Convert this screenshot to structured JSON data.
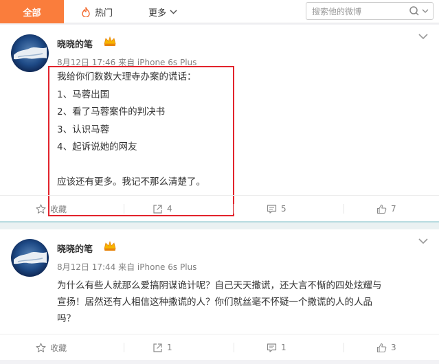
{
  "nav": {
    "tab_all": "全部",
    "tab_hot": "热门",
    "tab_more": "更多",
    "search_placeholder": "搜索他的微博"
  },
  "posts": [
    {
      "author": "晓晓的笔",
      "meta": "8月12日 17:46 来自 iPhone 6s Plus",
      "lines": [
        "我给你们数数大理寺办案的谎话：",
        "1、马蓉出国",
        "2、看了马蓉案件的判决书",
        "3、认识马蓉",
        "4、起诉说她的网友",
        "",
        "应该还有更多。我记不那么清楚了。"
      ],
      "actions": {
        "favorite": "收藏",
        "share": "4",
        "comment": "5",
        "like": "7"
      }
    },
    {
      "author": "晓晓的笔",
      "meta": "8月12日 17:44 来自 iPhone 6s Plus",
      "lines": [
        "为什么有些人就那么爱搞阴谋诡计呢？自己天天撒谎，还大言不惭的四处炫耀与",
        "宣扬！居然还有人相信这种撒谎的人？你们就丝毫不怀疑一个撒谎的人的人品",
        "吗？"
      ],
      "actions": {
        "favorite": "收藏",
        "share": "1",
        "comment": "1",
        "like": "3"
      }
    }
  ],
  "colors": {
    "accent": "#fa7d3c",
    "highlight_border": "#e2232c",
    "divider": "#b7dbe0"
  },
  "icons": [
    "fire-icon",
    "chevron-down-icon",
    "search-icon",
    "vip-badge-icon",
    "star-icon",
    "share-icon",
    "comment-icon",
    "like-icon"
  ]
}
